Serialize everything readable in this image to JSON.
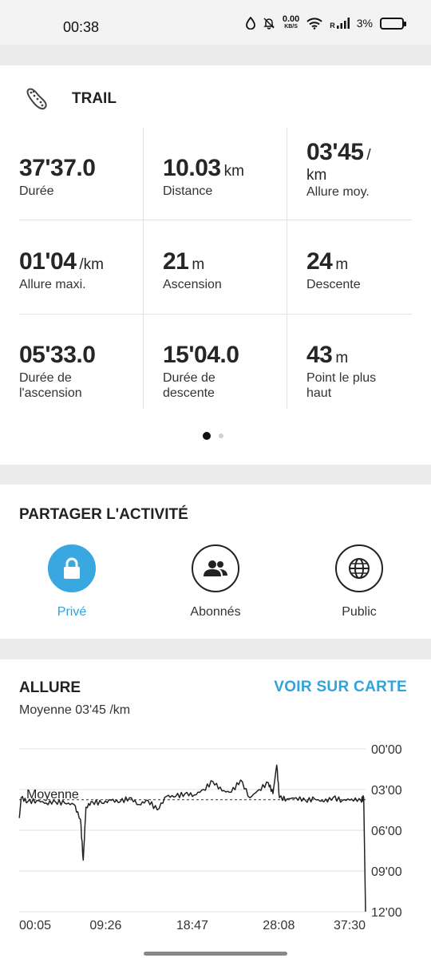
{
  "status_bar": {
    "time": "00:38",
    "net_speed_value": "0.00",
    "net_speed_unit": "KB/S",
    "signal_label": "R",
    "battery": "3%",
    "icons": [
      "water-drop-icon",
      "bell-off-icon",
      "wifi-icon",
      "signal-icon",
      "battery-icon"
    ]
  },
  "activity": {
    "icon": "shoe-sole-icon",
    "title": "TRAIL",
    "stats": [
      {
        "value": "37'37.0",
        "unit": "",
        "label": "Durée"
      },
      {
        "value": "10.03",
        "unit": "km",
        "label": "Distance"
      },
      {
        "value": "03'45",
        "unit": "/",
        "label": "km Allure moy."
      },
      {
        "value": "01'04",
        "unit": "/km",
        "label": "Allure maxi."
      },
      {
        "value": "21",
        "unit": "m",
        "label": "Ascension"
      },
      {
        "value": "24",
        "unit": "m",
        "label": "Descente"
      },
      {
        "value": "05'33.0",
        "unit": "",
        "label": "Durée de l'ascension"
      },
      {
        "value": "15'04.0",
        "unit": "",
        "label": "Durée de descente"
      },
      {
        "value": "43",
        "unit": "m",
        "label": "Point le plus haut"
      }
    ],
    "allure_unit_line": "km",
    "allure_label": "Allure moy."
  },
  "share": {
    "title": "PARTAGER L'ACTIVITÉ",
    "options": [
      {
        "label": "Privé",
        "icon": "lock-icon",
        "selected": true
      },
      {
        "label": "Abonnés",
        "icon": "people-icon",
        "selected": false
      },
      {
        "label": "Public",
        "icon": "globe-icon",
        "selected": false
      }
    ]
  },
  "pace": {
    "title": "ALLURE",
    "see_map": "VOIR SUR CARTE",
    "average_text": "Moyenne 03'45 /km",
    "average_marker": "Moyenne"
  },
  "chart_data": {
    "type": "line",
    "title": "",
    "x_ticks": [
      "00:05",
      "09:26",
      "18:47",
      "28:08",
      "37:30"
    ],
    "y_ticks": [
      "00'00",
      "03'00",
      "06'00",
      "09'00",
      "12'00"
    ],
    "y_inverted": true,
    "ylim_minutes": [
      0,
      12
    ],
    "xlim_minutes": [
      0.08,
      37.5
    ],
    "average_minutes": 3.75,
    "series": [
      {
        "x": [
          0.1,
          0.3,
          1,
          2,
          3,
          4,
          5,
          6,
          6.7,
          7,
          7.3,
          8,
          9,
          10,
          11,
          12,
          13,
          14,
          15,
          16,
          17,
          18,
          19,
          20,
          21,
          22,
          23,
          24,
          25,
          26,
          27,
          27.5,
          27.9,
          28.2,
          29,
          30,
          31,
          32,
          33,
          34,
          35,
          36,
          37,
          37.3,
          37.5
        ],
        "y": [
          5.1,
          3.6,
          3.9,
          3.8,
          4.0,
          3.9,
          4.0,
          4.1,
          5.2,
          8.2,
          4.3,
          3.9,
          4.0,
          3.8,
          3.9,
          3.6,
          4.1,
          3.8,
          4.5,
          3.5,
          3.5,
          3.3,
          3.4,
          3.0,
          2.4,
          3.1,
          3.2,
          2.3,
          3.6,
          3.0,
          2.5,
          3.3,
          1.2,
          3.6,
          3.7,
          3.6,
          3.8,
          3.7,
          3.9,
          3.6,
          3.8,
          3.7,
          3.8,
          3.6,
          12
        ]
      }
    ]
  }
}
